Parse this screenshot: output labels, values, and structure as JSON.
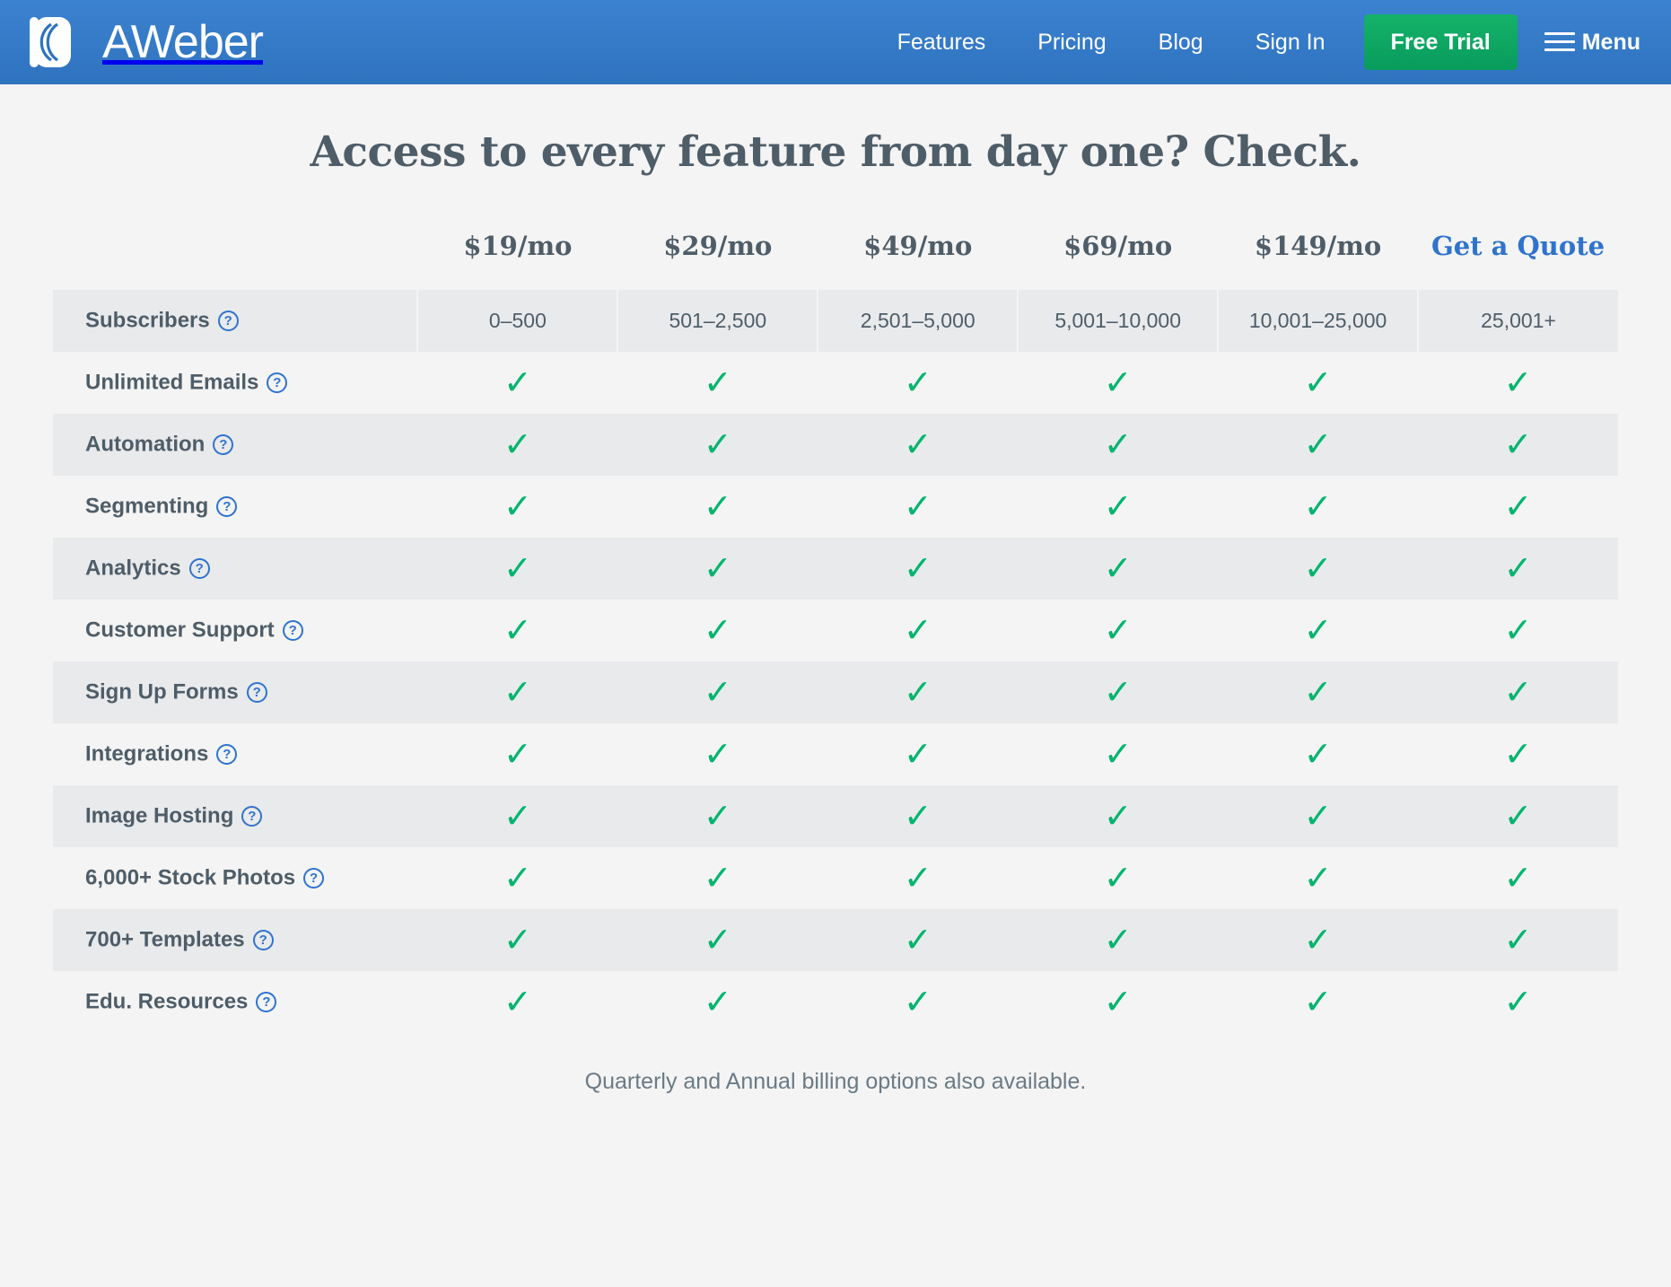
{
  "header": {
    "brand": {
      "name": "AWeber",
      "logo_icon": "aweber-logo-icon"
    },
    "nav_links": [
      {
        "label": "Features"
      },
      {
        "label": "Pricing"
      },
      {
        "label": "Blog"
      },
      {
        "label": "Sign In"
      }
    ],
    "cta": {
      "label": "Free Trial",
      "color": "#089b5c"
    },
    "menu": {
      "label": "Menu",
      "icon": "hamburger-icon"
    },
    "background_color": "#2f73bf"
  },
  "page": {
    "title": "Access to every feature from day one? Check.",
    "footnote": "Quarterly and Annual billing options also available.",
    "background_color": "#f4f4f4",
    "text_color": "#4e5d68",
    "link_color": "#2f73cc",
    "check_color": "#00b56e"
  },
  "table": {
    "feature_column_header": "",
    "plan_headers": [
      {
        "label": "$19/mo",
        "is_link": false
      },
      {
        "label": "$29/mo",
        "is_link": false
      },
      {
        "label": "$49/mo",
        "is_link": false
      },
      {
        "label": "$69/mo",
        "is_link": false
      },
      {
        "label": "$149/mo",
        "is_link": false
      },
      {
        "label": "Get a Quote",
        "is_link": true
      }
    ],
    "rows": [
      {
        "feature": "Subscribers",
        "has_help": true,
        "type": "text",
        "values": [
          "0–500",
          "501–2,500",
          "2,501–5,000",
          "5,001–10,000",
          "10,001–25,000",
          "25,001+"
        ]
      },
      {
        "feature": "Unlimited Emails",
        "has_help": true,
        "type": "check",
        "values": [
          "✓",
          "✓",
          "✓",
          "✓",
          "✓",
          "✓"
        ]
      },
      {
        "feature": "Automation",
        "has_help": true,
        "type": "check",
        "values": [
          "✓",
          "✓",
          "✓",
          "✓",
          "✓",
          "✓"
        ]
      },
      {
        "feature": "Segmenting",
        "has_help": true,
        "type": "check",
        "values": [
          "✓",
          "✓",
          "✓",
          "✓",
          "✓",
          "✓"
        ]
      },
      {
        "feature": "Analytics",
        "has_help": true,
        "type": "check",
        "values": [
          "✓",
          "✓",
          "✓",
          "✓",
          "✓",
          "✓"
        ]
      },
      {
        "feature": "Customer Support",
        "has_help": true,
        "type": "check",
        "values": [
          "✓",
          "✓",
          "✓",
          "✓",
          "✓",
          "✓"
        ]
      },
      {
        "feature": "Sign Up Forms",
        "has_help": true,
        "type": "check",
        "values": [
          "✓",
          "✓",
          "✓",
          "✓",
          "✓",
          "✓"
        ]
      },
      {
        "feature": "Integrations",
        "has_help": true,
        "type": "check",
        "values": [
          "✓",
          "✓",
          "✓",
          "✓",
          "✓",
          "✓"
        ]
      },
      {
        "feature": "Image Hosting",
        "has_help": true,
        "type": "check",
        "values": [
          "✓",
          "✓",
          "✓",
          "✓",
          "✓",
          "✓"
        ]
      },
      {
        "feature": "6,000+ Stock Photos",
        "has_help": true,
        "type": "check",
        "values": [
          "✓",
          "✓",
          "✓",
          "✓",
          "✓",
          "✓"
        ]
      },
      {
        "feature": "700+ Templates",
        "has_help": true,
        "type": "check",
        "values": [
          "✓",
          "✓",
          "✓",
          "✓",
          "✓",
          "✓"
        ]
      },
      {
        "feature": "Edu. Resources",
        "has_help": true,
        "type": "check",
        "values": [
          "✓",
          "✓",
          "✓",
          "✓",
          "✓",
          "✓"
        ]
      }
    ],
    "help_icon_glyph": "?"
  }
}
